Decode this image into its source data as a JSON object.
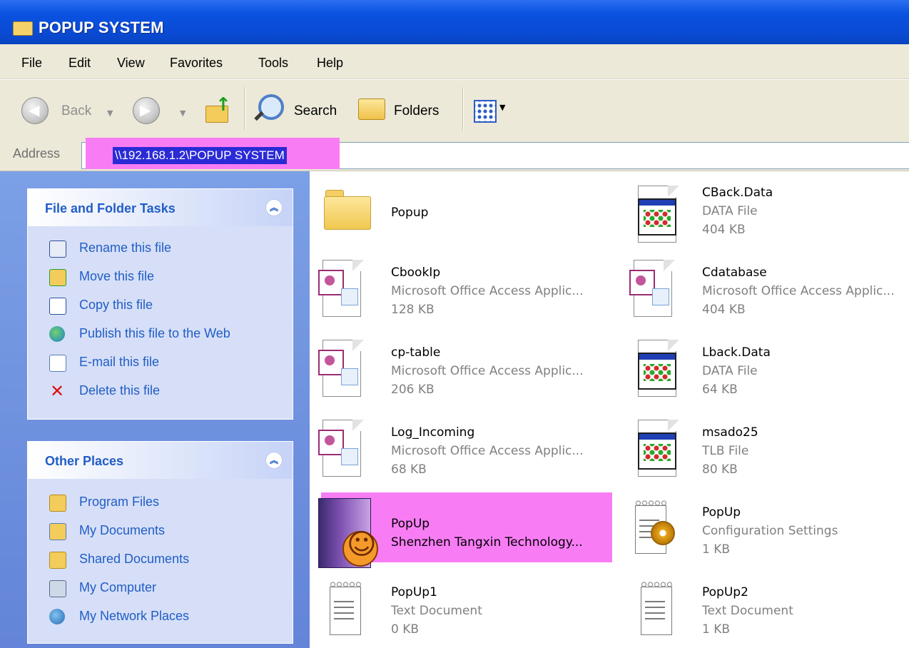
{
  "window": {
    "title": "POPUP SYSTEM"
  },
  "menu": [
    "File",
    "Edit",
    "View",
    "Favorites",
    "Tools",
    "Help"
  ],
  "toolbar": {
    "back_label": "Back",
    "search_label": "Search",
    "folders_label": "Folders"
  },
  "address": {
    "label": "Address",
    "value": "\\\\192.168.1.2\\POPUP SYSTEM"
  },
  "tasks_panel": {
    "title": "File and Folder Tasks",
    "items": [
      {
        "label": "Rename this file",
        "icon": "rename-icon"
      },
      {
        "label": "Move this file",
        "icon": "move-icon"
      },
      {
        "label": "Copy this file",
        "icon": "copy-icon"
      },
      {
        "label": "Publish this file to the Web",
        "icon": "publish-web-icon"
      },
      {
        "label": "E-mail this file",
        "icon": "email-icon"
      },
      {
        "label": "Delete this file",
        "icon": "delete-icon"
      }
    ]
  },
  "places_panel": {
    "title": "Other Places",
    "items": [
      {
        "label": "Program Files",
        "icon": "folder-icon"
      },
      {
        "label": "My Documents",
        "icon": "my-documents-icon"
      },
      {
        "label": "Shared Documents",
        "icon": "folder-icon"
      },
      {
        "label": "My Computer",
        "icon": "my-computer-icon"
      },
      {
        "label": "My Network Places",
        "icon": "network-places-icon"
      }
    ]
  },
  "files": [
    {
      "name": "Popup",
      "type": "",
      "size": "",
      "icon": "folder-icon"
    },
    {
      "name": "CBack.Data",
      "type": "DATA File",
      "size": "404 KB",
      "icon": "data-file-icon"
    },
    {
      "name": "CbookIp",
      "type": "Microsoft Office Access Applic...",
      "size": "128 KB",
      "icon": "access-db-icon"
    },
    {
      "name": "Cdatabase",
      "type": "Microsoft Office Access Applic...",
      "size": "404 KB",
      "icon": "access-db-icon"
    },
    {
      "name": "cp-table",
      "type": "Microsoft Office Access Applic...",
      "size": "206 KB",
      "icon": "access-db-icon"
    },
    {
      "name": "Lback.Data",
      "type": "DATA File",
      "size": "64 KB",
      "icon": "data-file-icon"
    },
    {
      "name": "Log_Incoming",
      "type": "Microsoft Office Access Applic...",
      "size": "68 KB",
      "icon": "access-db-icon"
    },
    {
      "name": "msado25",
      "type": "TLB File",
      "size": "80 KB",
      "icon": "data-file-icon"
    },
    {
      "name": "PopUp",
      "type": "Shenzhen Tangxin Technology...",
      "size": "",
      "icon": "application-icon"
    },
    {
      "name": "PopUp",
      "type": "Configuration Settings",
      "size": "1 KB",
      "icon": "config-settings-icon"
    },
    {
      "name": "PopUp1",
      "type": "Text Document",
      "size": "0 KB",
      "icon": "text-document-icon"
    },
    {
      "name": "PopUp2",
      "type": "Text Document",
      "size": "1 KB",
      "icon": "text-document-icon"
    }
  ]
}
